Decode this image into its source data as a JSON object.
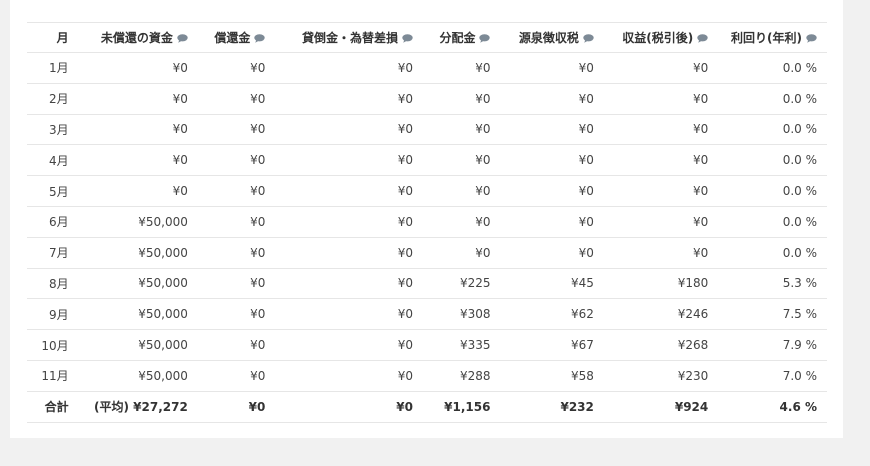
{
  "table": {
    "headers": [
      {
        "label": "月",
        "has_info": false
      },
      {
        "label": "未償還の資金",
        "has_info": true
      },
      {
        "label": "償還金",
        "has_info": true
      },
      {
        "label": "貸倒金・為替差損",
        "has_info": true
      },
      {
        "label": "分配金",
        "has_info": true
      },
      {
        "label": "源泉徴収税",
        "has_info": true
      },
      {
        "label": "収益(税引後)",
        "has_info": true
      },
      {
        "label": "利回り(年利)",
        "has_info": true
      }
    ],
    "info_icon": "speech-bubble-icon",
    "info_icon_color": "#7d8a96",
    "rows": [
      [
        "1月",
        "¥0",
        "¥0",
        "¥0",
        "¥0",
        "¥0",
        "¥0",
        "0.0 %"
      ],
      [
        "2月",
        "¥0",
        "¥0",
        "¥0",
        "¥0",
        "¥0",
        "¥0",
        "0.0 %"
      ],
      [
        "3月",
        "¥0",
        "¥0",
        "¥0",
        "¥0",
        "¥0",
        "¥0",
        "0.0 %"
      ],
      [
        "4月",
        "¥0",
        "¥0",
        "¥0",
        "¥0",
        "¥0",
        "¥0",
        "0.0 %"
      ],
      [
        "5月",
        "¥0",
        "¥0",
        "¥0",
        "¥0",
        "¥0",
        "¥0",
        "0.0 %"
      ],
      [
        "6月",
        "¥50,000",
        "¥0",
        "¥0",
        "¥0",
        "¥0",
        "¥0",
        "0.0 %"
      ],
      [
        "7月",
        "¥50,000",
        "¥0",
        "¥0",
        "¥0",
        "¥0",
        "¥0",
        "0.0 %"
      ],
      [
        "8月",
        "¥50,000",
        "¥0",
        "¥0",
        "¥225",
        "¥45",
        "¥180",
        "5.3 %"
      ],
      [
        "9月",
        "¥50,000",
        "¥0",
        "¥0",
        "¥308",
        "¥62",
        "¥246",
        "7.5 %"
      ],
      [
        "10月",
        "¥50,000",
        "¥0",
        "¥0",
        "¥335",
        "¥67",
        "¥268",
        "7.9 %"
      ],
      [
        "11月",
        "¥50,000",
        "¥0",
        "¥0",
        "¥288",
        "¥58",
        "¥230",
        "7.0 %"
      ]
    ],
    "total": [
      "合計",
      "(平均) ¥27,272",
      "¥0",
      "¥0",
      "¥1,156",
      "¥232",
      "¥924",
      "4.6 %"
    ]
  }
}
